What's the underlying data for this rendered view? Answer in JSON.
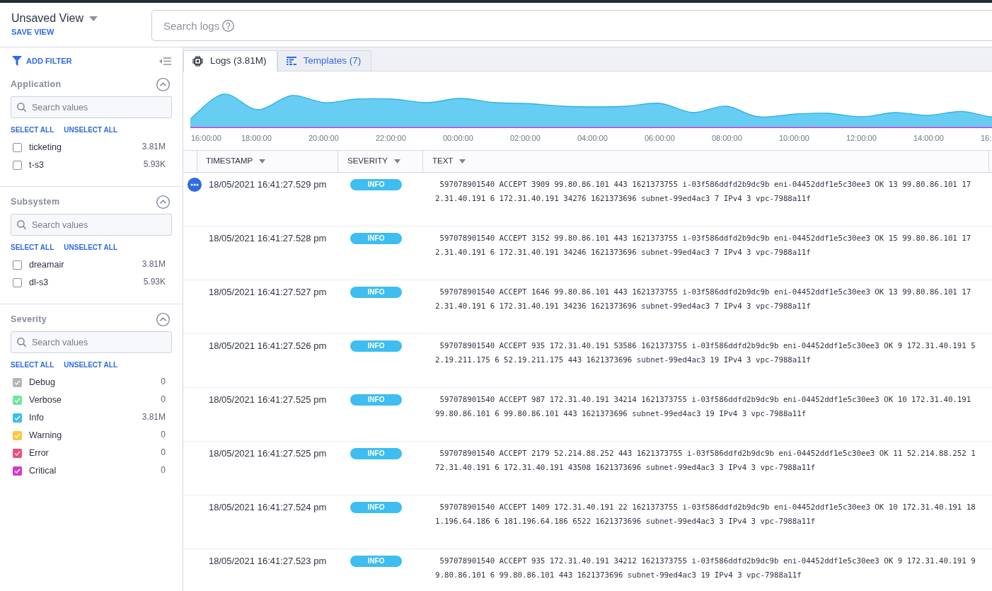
{
  "header": {
    "view_title": "Unsaved View",
    "save_view": "SAVE VIEW",
    "search": {
      "placeholder": "Search logs"
    }
  },
  "sidebar": {
    "add_filter": "ADD FILTER",
    "sections": [
      {
        "title": "Application",
        "expanded": true,
        "search": {
          "placeholder": "Search values"
        },
        "select_all": "SELECT ALL",
        "unselect_all": "UNSELECT ALL",
        "items": [
          {
            "label": "ticketing",
            "count": "3.81M",
            "checked": false
          },
          {
            "label": "t-s3",
            "count": "5.93K",
            "checked": false
          }
        ]
      },
      {
        "title": "Subsystem",
        "expanded": true,
        "search": {
          "placeholder": "Search values"
        },
        "select_all": "SELECT ALL",
        "unselect_all": "UNSELECT ALL",
        "items": [
          {
            "label": "dreamair",
            "count": "3.81M",
            "checked": false
          },
          {
            "label": "dl-s3",
            "count": "5.93K",
            "checked": false
          }
        ]
      },
      {
        "title": "Severity",
        "expanded": true,
        "search": {
          "placeholder": "Search values"
        },
        "select_all": "SELECT ALL",
        "unselect_all": "UNSELECT ALL",
        "items": [
          {
            "label": "Debug",
            "count": "0",
            "checked": true,
            "color": "#b5b5b5"
          },
          {
            "label": "Verbose",
            "count": "0",
            "checked": true,
            "color": "#6ee6a0"
          },
          {
            "label": "Info",
            "count": "3.81M",
            "checked": true,
            "color": "#3dbdf0"
          },
          {
            "label": "Warning",
            "count": "0",
            "checked": true,
            "color": "#fdc540"
          },
          {
            "label": "Error",
            "count": "0",
            "checked": true,
            "color": "#f04d7a"
          },
          {
            "label": "Critical",
            "count": "0",
            "checked": true,
            "color": "#d53ac8"
          }
        ]
      }
    ]
  },
  "tabs": [
    {
      "label": "Logs (3.81M)",
      "selected": true
    },
    {
      "label": "Templates (7)",
      "selected": false
    }
  ],
  "histogram": {
    "x_labels": [
      "16:00:00",
      "18:00:00",
      "20:00:00",
      "22:00:00",
      "00:00:00",
      "02:00:00",
      "04:00:00",
      "06:00:00",
      "08:00:00",
      "10:00:00",
      "12:00:00",
      "14:00:00",
      "16:"
    ]
  },
  "table": {
    "columns": [
      "TIMESTAMP",
      "SEVERITY",
      "TEXT"
    ],
    "rows": [
      {
        "hovered": true,
        "timestamp": "18/05/2021 16:41:27.529 pm",
        "severity": "INFO",
        "text": " 597078901540 ACCEPT 3909 99.80.86.101 443 1621373755 i-03f586ddfd2b9dc9b eni-04452ddf1e5c30ee3 OK 13 99.80.86.101 172.31.40.191 6 172.31.40.191 34276 1621373696 subnet-99ed4ac3 7 IPv4 3 vpc-7988a11f"
      },
      {
        "hovered": false,
        "timestamp": "18/05/2021 16:41:27.528 pm",
        "severity": "INFO",
        "text": " 597078901540 ACCEPT 3152 99.80.86.101 443 1621373755 i-03f586ddfd2b9dc9b eni-04452ddf1e5c30ee3 OK 15 99.80.86.101 172.31.40.191 6 172.31.40.191 34246 1621373696 subnet-99ed4ac3 7 IPv4 3 vpc-7988a11f"
      },
      {
        "hovered": false,
        "timestamp": "18/05/2021 16:41:27.527 pm",
        "severity": "INFO",
        "text": " 597078901540 ACCEPT 1646 99.80.86.101 443 1621373755 i-03f586ddfd2b9dc9b eni-04452ddf1e5c30ee3 OK 13 99.80.86.101 172.31.40.191 6 172.31.40.191 34236 1621373696 subnet-99ed4ac3 7 IPv4 3 vpc-7988a11f"
      },
      {
        "hovered": false,
        "timestamp": "18/05/2021 16:41:27.526 pm",
        "severity": "INFO",
        "text": " 597078901540 ACCEPT 935 172.31.40.191 53586 1621373755 i-03f586ddfd2b9dc9b eni-04452ddf1e5c30ee3 OK 9 172.31.40.191 52.19.211.175 6 52.19.211.175 443 1621373696 subnet-99ed4ac3 19 IPv4 3 vpc-7988a11f"
      },
      {
        "hovered": false,
        "timestamp": "18/05/2021 16:41:27.525 pm",
        "severity": "INFO",
        "text": " 597078901540 ACCEPT 987 172.31.40.191 34214 1621373755 i-03f586ddfd2b9dc9b eni-04452ddf1e5c30ee3 OK 10 172.31.40.191 99.80.86.101 6 99.80.86.101 443 1621373696 subnet-99ed4ac3 19 IPv4 3 vpc-7988a11f"
      },
      {
        "hovered": false,
        "timestamp": "18/05/2021 16:41:27.525 pm",
        "severity": "INFO",
        "text": " 597078901540 ACCEPT 2179 52.214.88.252 443 1621373755 i-03f586ddfd2b9dc9b eni-04452ddf1e5c30ee3 OK 11 52.214.88.252 172.31.40.191 6 172.31.40.191 43508 1621373696 subnet-99ed4ac3 3 IPv4 3 vpc-7988a11f"
      },
      {
        "hovered": false,
        "timestamp": "18/05/2021 16:41:27.524 pm",
        "severity": "INFO",
        "text": " 597078901540 ACCEPT 1409 172.31.40.191 22 1621373755 i-03f586ddfd2b9dc9b eni-04452ddf1e5c30ee3 OK 10 172.31.40.191 181.196.64.186 6 181.196.64.186 6522 1621373696 subnet-99ed4ac3 3 IPv4 3 vpc-7988a11f"
      },
      {
        "hovered": false,
        "timestamp": "18/05/2021 16:41:27.523 pm",
        "severity": "INFO",
        "text": " 597078901540 ACCEPT 935 172.31.40.191 34212 1621373755 i-03f586ddfd2b9dc9b eni-04452ddf1e5c30ee3 OK 9 172.31.40.191 99.80.86.101 6 99.80.86.101 443 1621373696 subnet-99ed4ac3 19 IPv4 3 vpc-7988a11f"
      }
    ]
  }
}
